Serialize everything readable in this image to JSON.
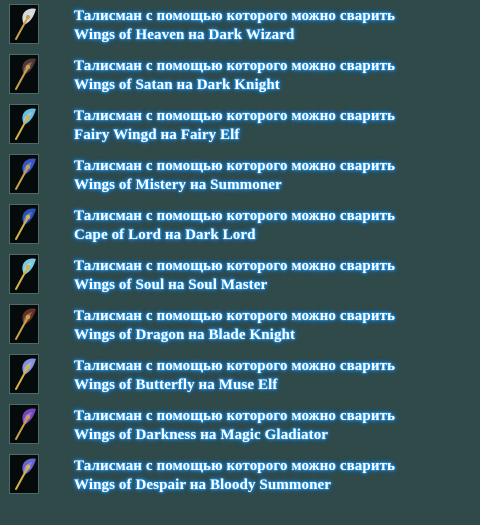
{
  "items": [
    {
      "line1": "Талисман с помощью которого можно сварить",
      "line2": "Wings of Heaven на Dark Wizard",
      "icon": "white-wings-icon",
      "wing_color": "#dfe6ea",
      "staff_color": "#c9a24a"
    },
    {
      "line1": "Талисман с помощью которого можно сварить",
      "line2": "Wings of Satan на Dark Knight",
      "icon": "dark-wings-icon",
      "wing_color": "#5a3a3a",
      "staff_color": "#c9a24a"
    },
    {
      "line1": "Талисман с помощью которого можно сварить",
      "line2": "Fairy  Wingd на Fairy Elf",
      "icon": "fairy-wings-icon",
      "wing_color": "#6fc6f0",
      "staff_color": "#d8b24a"
    },
    {
      "line1": "Талисман с помощью которого можно сварить",
      "line2": "Wings of Mistery на Summoner",
      "icon": "blue-wings-icon",
      "wing_color": "#3a5ad0",
      "staff_color": "#c9a24a"
    },
    {
      "line1": "Талисман с помощью которого можно сварить",
      "line2": "Cape of Lord на Dark Lord",
      "icon": "cape-icon",
      "wing_color": "#2a56c0",
      "staff_color": "#d8b24a"
    },
    {
      "line1": "Талисман с помощью которого можно сварить",
      "line2": "Wings of Soul на Soul Master",
      "icon": "cyan-wings-icon",
      "wing_color": "#7fd6f0",
      "staff_color": "#d8b24a"
    },
    {
      "line1": "Талисман с помощью которого можно сварить",
      "line2": "Wings of Dragon на Blade Knight",
      "icon": "dragon-wings-icon",
      "wing_color": "#6a3426",
      "staff_color": "#c9a24a"
    },
    {
      "line1": "Талисман с помощью которого можно сварить",
      "line2": "Wings of Butterfly на Muse Elf",
      "icon": "butterfly-wings-icon",
      "wing_color": "#8a9ce8",
      "staff_color": "#d8b24a"
    },
    {
      "line1": "Талисман с помощью которого можно сварить",
      "line2": "Wings of Darkness на Magic Gladiator",
      "icon": "purple-wings-icon",
      "wing_color": "#7a4ad0",
      "staff_color": "#c9a24a"
    },
    {
      "line1": "Талисман с помощью которого можно сварить",
      "line2": "Wings of Despair на Bloody Summoner",
      "icon": "violet-wings-icon",
      "wing_color": "#6a6ae0",
      "staff_color": "#d8b24a"
    }
  ]
}
